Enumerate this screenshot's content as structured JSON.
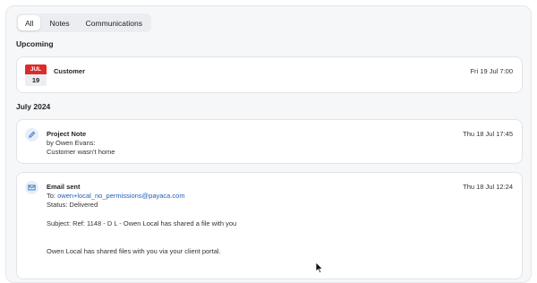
{
  "tabs": [
    {
      "label": "All",
      "active": true
    },
    {
      "label": "Notes",
      "active": false
    },
    {
      "label": "Communications",
      "active": false
    }
  ],
  "upcoming": {
    "title": "Upcoming",
    "event": {
      "month": "JUL",
      "day": "19",
      "title": "Customer",
      "time": "Fri 19 Jul 7:00"
    }
  },
  "month_section": {
    "title": "July 2024"
  },
  "note": {
    "icon": "pencil-icon",
    "title": "Project Note",
    "author": "by Owen Evans:",
    "body": "Customer wasn't home",
    "time": "Thu 18 Jul 17:45"
  },
  "email": {
    "icon": "envelope-icon",
    "title": "Email sent",
    "to_label": "To:",
    "to_address": "owen+local_no_permissions@payaca.com",
    "status": "Status: Delivered",
    "subject": "Subject: Ref: 1148 - D L - Owen Local has shared a file with you",
    "body": "Owen Local has shared files with you via your client portal.",
    "time": "Thu 18 Jul 12:24"
  },
  "colors": {
    "accent_red": "#dc2b2b",
    "link_blue": "#1f5fb8"
  }
}
